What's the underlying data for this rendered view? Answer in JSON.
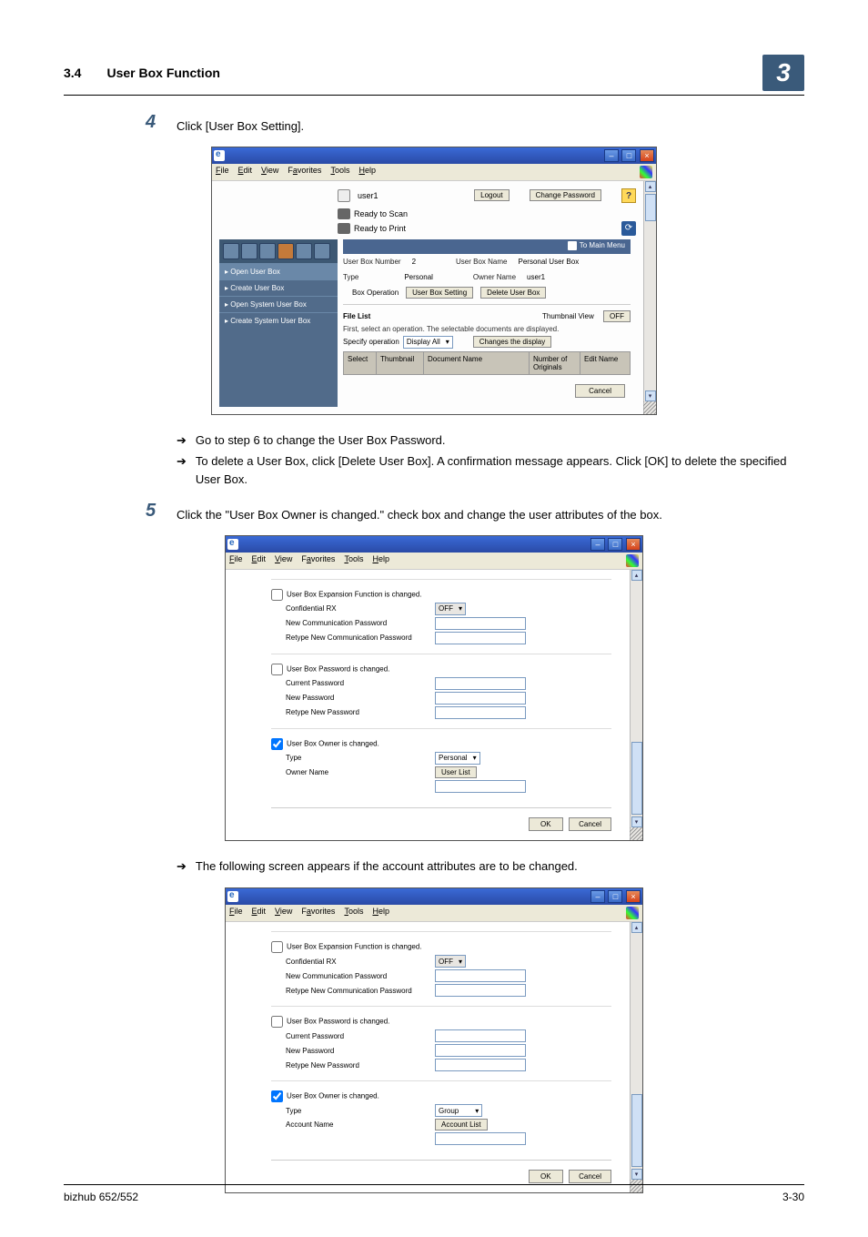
{
  "header": {
    "section_num": "3.4",
    "section_title": "User Box Function",
    "chapter": "3"
  },
  "step4": {
    "num": "4",
    "text": "Click [User Box Setting]."
  },
  "bullets1": {
    "b1": "Go to step 6 to change the User Box Password.",
    "b2": "To delete a User Box, click [Delete User Box]. A confirmation message appears. Click [OK] to delete the specified User Box."
  },
  "step5": {
    "num": "5",
    "text": "Click the \"User Box Owner is changed.\" check box and change the user attributes of the box."
  },
  "bullets2": {
    "b1": "The following screen appears if the account attributes are to be changed."
  },
  "win_menu": {
    "file": "File",
    "edit": "Edit",
    "view": "View",
    "favorites": "Favorites",
    "tools": "Tools",
    "help": "Help"
  },
  "win_btns": {
    "min": "–",
    "max": "□",
    "close": "×"
  },
  "s1": {
    "user": "user1",
    "logout": "Logout",
    "change_pw": "Change Password",
    "ready_scan": "Ready to Scan",
    "ready_print": "Ready to Print",
    "to_main": "To Main Menu",
    "nav": {
      "open": "▸ Open User Box",
      "create": "▸ Create User Box",
      "open_sys": "▸ Open System User Box",
      "create_sys": "▸ Create System User Box"
    },
    "info": {
      "ubn_l": "User Box Number",
      "ubn_v": "2",
      "ubname_l": "User Box Name",
      "ubname_v": "Personal User Box",
      "type_l": "Type",
      "type_v": "Personal",
      "owner_l": "Owner Name",
      "owner_v": "user1"
    },
    "ops": {
      "box_op": "Box Operation",
      "ub_setting": "User Box Setting",
      "del_ub": "Delete User Box"
    },
    "file_list": "File List",
    "thumb_view": "Thumbnail View",
    "off": "OFF",
    "hint": "First, select an operation. The selectable documents are displayed.",
    "spec_l": "Specify operation",
    "spec_v": "Display All",
    "chg_disp": "Changes the display",
    "th": {
      "sel": "Select",
      "thumb": "Thumbnail",
      "doc": "Document Name",
      "num": "Number of Originals",
      "edit": "Edit Name"
    },
    "cancel": "Cancel"
  },
  "s2": {
    "exp_chk": "User Box Expansion Function is changed.",
    "conf_rx": "Confidential RX",
    "off": "OFF",
    "new_comm": "New Communication Password",
    "ret_comm": "Retype New Communication Password",
    "pw_chk": "User Box Password is changed.",
    "cur_pw": "Current Password",
    "new_pw": "New Password",
    "ret_pw": "Retype New Password",
    "own_chk": "User Box Owner is changed.",
    "type_l": "Type",
    "type_v_personal": "Personal",
    "type_v_group": "Group",
    "owner_l": "Owner Name",
    "account_l": "Account Name",
    "user_list": "User List",
    "account_list": "Account List",
    "ok": "OK",
    "cancel": "Cancel"
  },
  "footer": {
    "model": "bizhub 652/552",
    "page": "3-30"
  },
  "arrow": "➔"
}
